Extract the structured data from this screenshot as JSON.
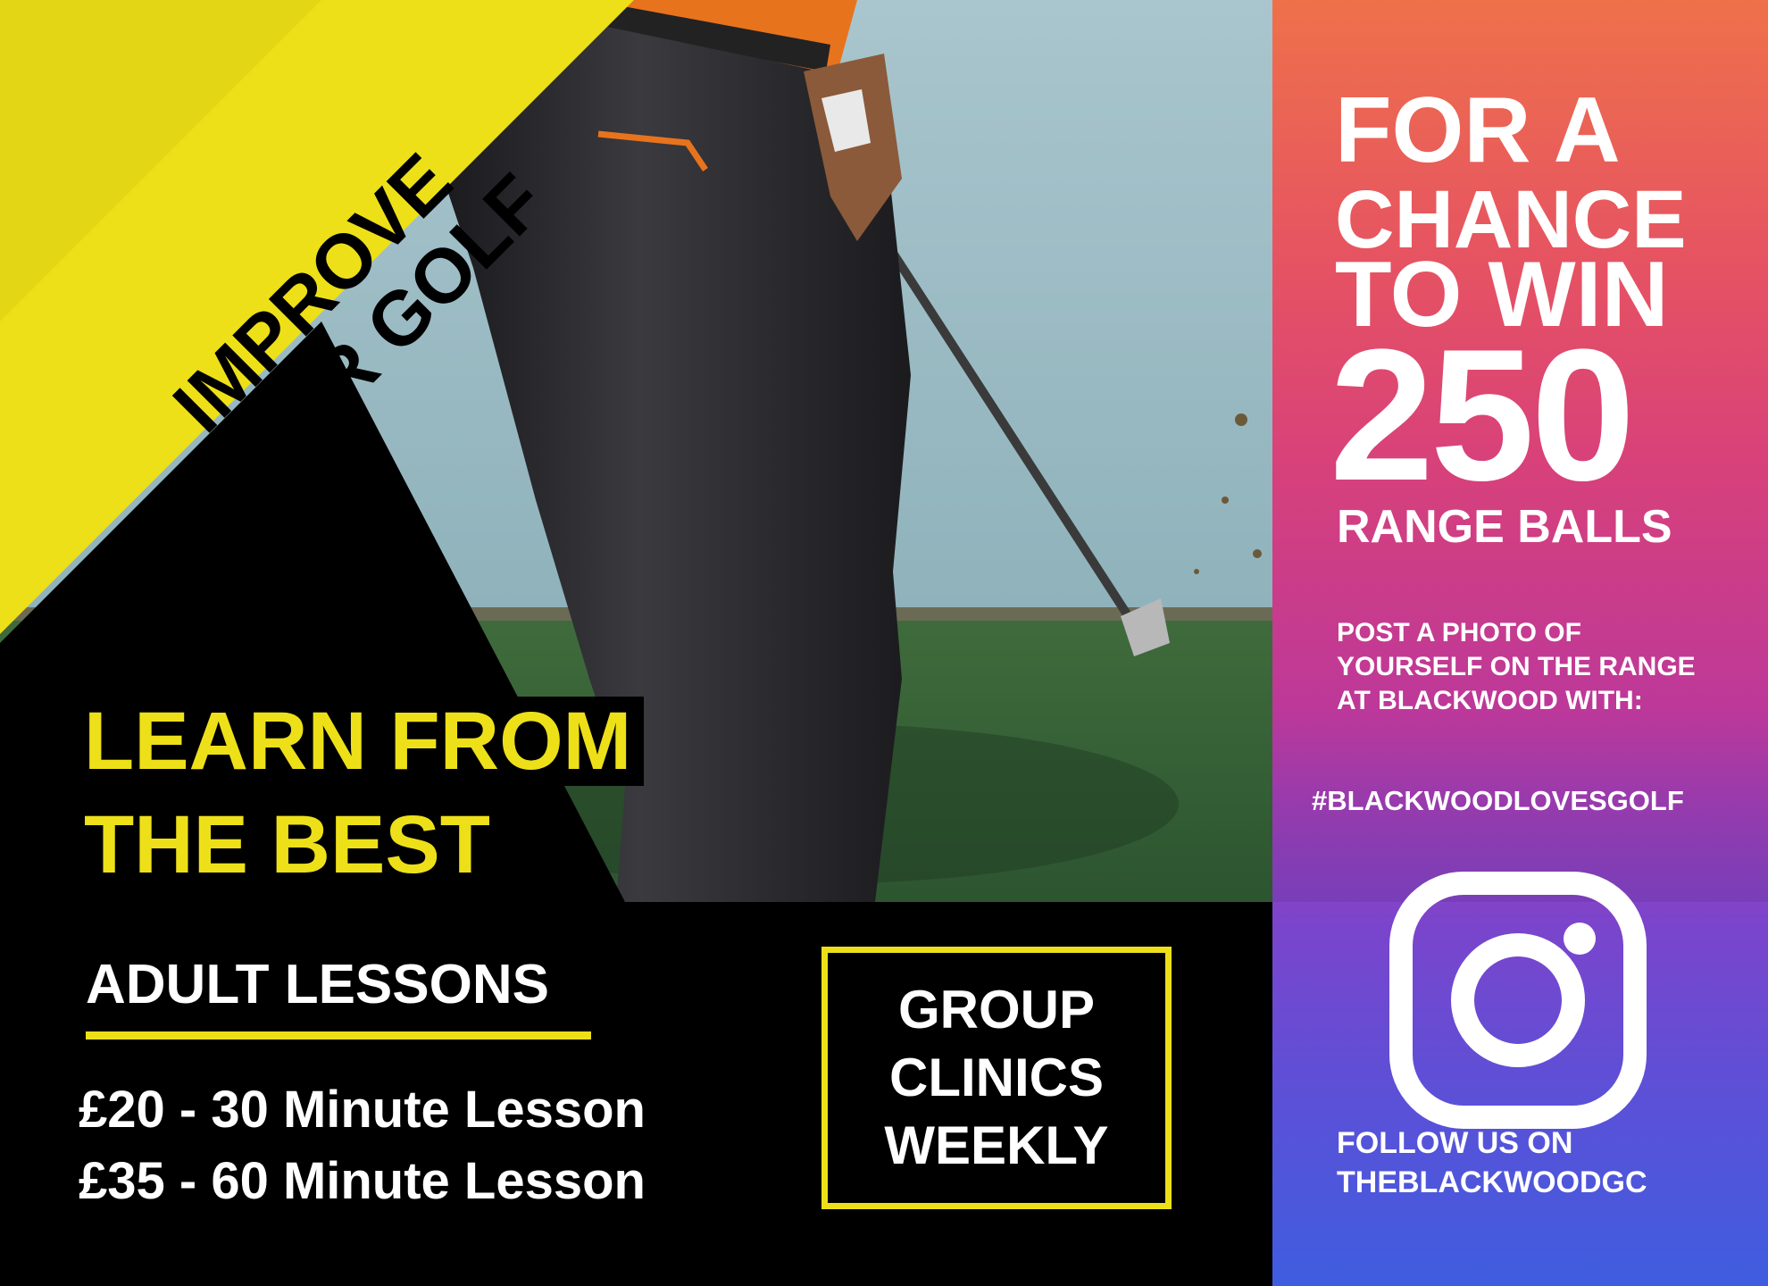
{
  "colors": {
    "yellow": "#ede019",
    "black": "#000000",
    "white": "#ffffff",
    "panel_top": "#ee6b43",
    "panel_mid": "#c93aa2",
    "panel_bottom": "#3f5ddf"
  },
  "corner": {
    "line1": "IMPROVE",
    "line2": "YOUR GOLF"
  },
  "headline": {
    "line1": "LEARN FROM",
    "line2": "THE BEST"
  },
  "adult": {
    "title": "ADULT LESSONS",
    "prices": [
      "£20 - 30 Minute Lesson",
      "£35 - 60 Minute Lesson"
    ]
  },
  "clinics": {
    "lines": [
      "GROUP",
      "CLINICS",
      "WEEKLY"
    ]
  },
  "promo": {
    "line1": "FOR A",
    "line2": "CHANCE",
    "line3": "TO WIN",
    "number": "250",
    "line4": "RANGE BALLS",
    "post_text": "POST A PHOTO OF YOURSELF ON THE RANGE AT BLACKWOOD WITH:",
    "hashtag": "#BLACKWOODLOVESGOLF",
    "follow_line1": "FOLLOW US ON",
    "follow_line2": "THEBLACKWOODGC"
  },
  "icons": {
    "social": "instagram-icon"
  }
}
